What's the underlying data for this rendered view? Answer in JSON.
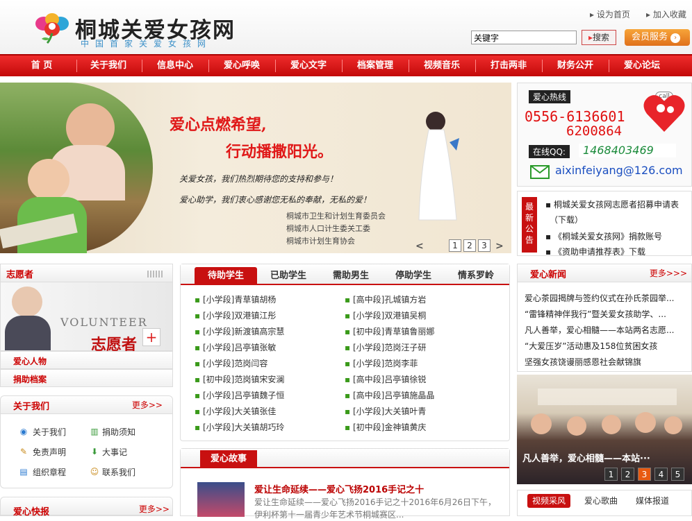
{
  "header": {
    "title": "桐城关爱女孩网",
    "subtitle": "中国首家关爱女孩网",
    "links": [
      "设为首页",
      "加入收藏"
    ],
    "search_placeholder": "关键字",
    "search_button": "搜索",
    "member_button": "会员服务"
  },
  "nav": [
    "首 页",
    "关于我们",
    "信息中心",
    "爱心呼唤",
    "爱心文字",
    "档案管理",
    "视频音乐",
    "打击两非",
    "财务公开",
    "爱心论坛"
  ],
  "banner": {
    "line1": "爱心点燃希望,",
    "line2": "行动播撒阳光。",
    "line3": "关爱女孩，我们热烈期待您的支持和参与！",
    "line4": "爱心助学，我们衷心感谢您无私的奉献，无私的爱！",
    "orgs": [
      "桐城市卫生和计划生育委员会",
      "桐城市人口计生委关工委",
      "桐城市计划生育协会"
    ],
    "slides": [
      "1",
      "2",
      "3"
    ],
    "prev": "<",
    "next": ">"
  },
  "hotline": {
    "label": "爱心热线",
    "phone1": "0556-6136601",
    "phone2": "6200864",
    "qq_label": "在线QQ:",
    "qq": "1468403469",
    "email": "aixinfeiyang@126.com",
    "call_badge": "call"
  },
  "latest": {
    "tag": "最新公告",
    "items": [
      "▪ 桐城关爱女孩网志愿者招募申请表",
      "（下载）",
      "▪ 《桐城关爱女孩网》捐款账号",
      "▪ 《资助申请推荐表》下载"
    ]
  },
  "volunteer": {
    "title": "志愿者",
    "image_word": "VOLUNTEER",
    "image_cn": "志愿者"
  },
  "left_rows": [
    "爱心人物",
    "捐助档案"
  ],
  "about": {
    "title": "关于我们",
    "more": "更多>>",
    "links": [
      "关于我们",
      "捐助须知",
      "免责声明",
      "大事记",
      "组织章程",
      "联系我们"
    ]
  },
  "kuaibao": {
    "title": "爱心快报",
    "more": "更多>>"
  },
  "students": {
    "tabs": [
      "待助学生",
      "已助学生",
      "需助男生",
      "停助学生",
      "情系罗岭"
    ],
    "left": [
      {
        "level": "[小学段]",
        "name": "青草镇胡杨"
      },
      {
        "level": "[小学段]",
        "name": "双港镇江彤"
      },
      {
        "level": "[小学段]",
        "name": "新渡镇高宗慧"
      },
      {
        "level": "[小学段]",
        "name": "吕亭镇张敏"
      },
      {
        "level": "[小学段]",
        "name": "范岗闫容"
      },
      {
        "level": "[初中段]",
        "name": "范岗镇宋安澜"
      },
      {
        "level": "[小学段]",
        "name": "吕亭镇魏子恒"
      },
      {
        "level": "[小学段]",
        "name": "大关镇张佳"
      },
      {
        "level": "[小学段]",
        "name": "大关镇胡巧玲"
      }
    ],
    "right": [
      {
        "level": "[高中段]",
        "name": "孔城镇方岩"
      },
      {
        "level": "[小学段]",
        "name": "双港镇吴桐"
      },
      {
        "level": "[初中段]",
        "name": "青草镇鲁丽娜"
      },
      {
        "level": "[小学段]",
        "name": "范岗汪子研"
      },
      {
        "level": "[小学段]",
        "name": "范岗李菲"
      },
      {
        "level": "[高中段]",
        "name": "吕亭镇徐锐"
      },
      {
        "level": "[高中段]",
        "name": "吕亭镇施晶晶"
      },
      {
        "level": "[小学段]",
        "name": "大关镇叶青"
      },
      {
        "level": "[初中段]",
        "name": "金神镇黄庆"
      }
    ]
  },
  "story": {
    "title": "爱心故事",
    "item_title": "爱让生命延续——爱心飞扬2016手记之十",
    "item_desc": "爱让生命延续——爱心飞扬2016手记之十2016年6月26日下午，伊利杯第十一届青少年艺术节桐城赛区..."
  },
  "news": {
    "title": "爱心新闻",
    "more": "更多>>>",
    "items": [
      "爱心茶园揭牌与签约仪式在孙氏茶园举...",
      "“雷锋精神伴我行”暨关爱女孩助学、...",
      "凡人善举，爱心相髓——本站两名志愿...",
      "“大爱压岁”活动惠及158位贫困女孩",
      "坚强女孩饶谩丽感恩社会献锦旗"
    ]
  },
  "photo": {
    "caption": "凡人善举，爱心相髓——本站···",
    "pages": [
      "1",
      "2",
      "3",
      "4",
      "5"
    ],
    "active_page": 3
  },
  "media": {
    "tabs": [
      "视频采风",
      "爱心歌曲",
      "媒体报道"
    ]
  },
  "colors": {
    "brand_red": "#c81010",
    "nav_red": "#e01818",
    "link_green": "#3a9a1a",
    "member_orange": "#e0701b"
  }
}
